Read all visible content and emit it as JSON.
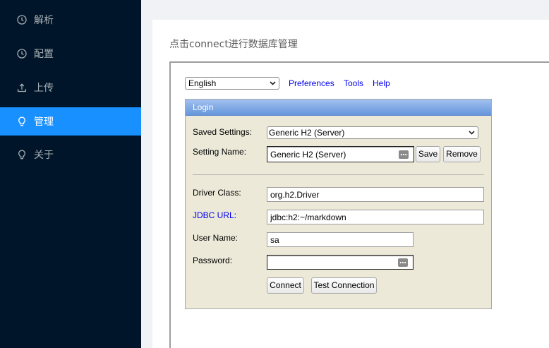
{
  "colors": {
    "sidebar_bg": "#001529",
    "menu_selected_bg": "#1890ff",
    "content_bg": "#f0f2f5",
    "link": "#0000ee",
    "login_bg": "#ece9d8"
  },
  "sidebar": {
    "items": [
      {
        "label": "解析",
        "icon": "clock-icon",
        "selected": false
      },
      {
        "label": "配置",
        "icon": "clock-icon",
        "selected": false
      },
      {
        "label": "上传",
        "icon": "upload-icon",
        "selected": false
      },
      {
        "label": "管理",
        "icon": "bulb-icon",
        "selected": true
      },
      {
        "label": "关于",
        "icon": "bulb-icon",
        "selected": false
      }
    ]
  },
  "main": {
    "hint": "点击connect进行数据库管理"
  },
  "console": {
    "language": "English",
    "links": [
      "Preferences",
      "Tools",
      "Help"
    ],
    "login": {
      "title": "Login",
      "saved_settings": {
        "label": "Saved Settings:",
        "value": "Generic H2 (Server)"
      },
      "setting_name": {
        "label": "Setting Name:",
        "value": "Generic H2 (Server)"
      },
      "save_button": "Save",
      "remove_button": "Remove",
      "driver_class": {
        "label": "Driver Class:",
        "value": "org.h2.Driver"
      },
      "jdbc_url": {
        "label": "JDBC URL:",
        "value": "jdbc:h2:~/markdown"
      },
      "user_name": {
        "label": "User Name:",
        "value": "sa"
      },
      "password": {
        "label": "Password:",
        "value": ""
      },
      "connect_button": "Connect",
      "test_connection_button": "Test Connection"
    }
  }
}
